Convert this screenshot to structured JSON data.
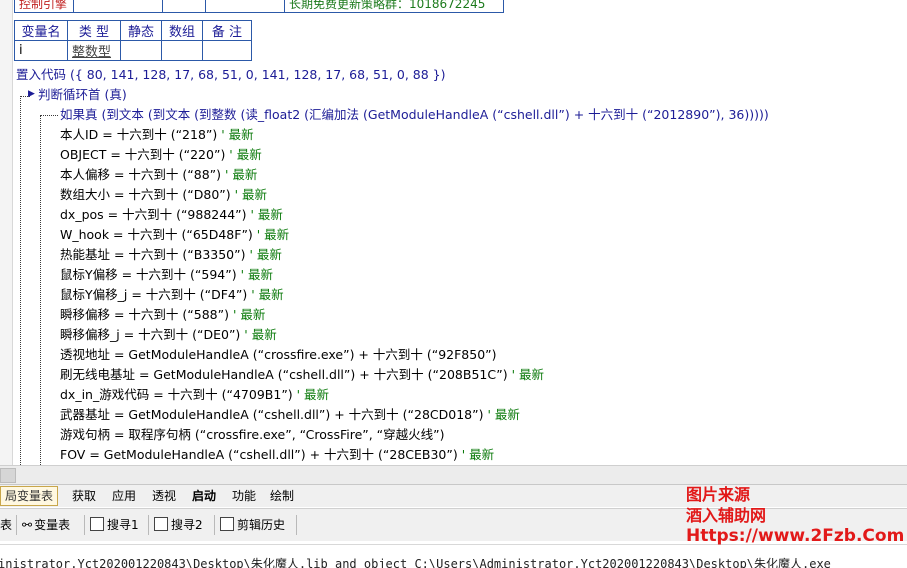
{
  "top_table": {
    "cell1": "控制引擎",
    "cell5": "长期免费更新策略群：1018672245"
  },
  "var_table": {
    "headers": [
      "变量名",
      "类 型",
      "静态",
      "数组",
      "备 注"
    ],
    "row": [
      "i",
      "整数型",
      "",
      "",
      ""
    ]
  },
  "code": {
    "embed": "置入代码 ({ 80, 141, 128, 17, 68, 51, 0, 141, 128, 17, 68, 51, 0, 88 })",
    "loop": "判断循环首 (真)",
    "if_line": "如果真 (到文本 (到文本 (到整数 (读_float2 (汇编加法 (GetModuleHandleA (“cshell.dll”) + 十六到十 (“2012890”), 36)))))",
    "lines": [
      "本人ID = 十六到十 (“218”) ' 最新",
      "OBJECT = 十六到十 (“220”) ' 最新",
      "本人偏移 = 十六到十 (“88”) ' 最新",
      "数组大小 = 十六到十 (“D80”) ' 最新",
      "dx_pos = 十六到十 (“988244”) ' 最新",
      "W_hook = 十六到十 (“65D48F”) ' 最新",
      "热能基址 = 十六到十 (“B3350”) ' 最新",
      "鼠标Y偏移 = 十六到十 (“594”) ' 最新",
      "鼠标Y偏移_j = 十六到十 (“DF4”) ' 最新",
      "瞬移偏移 = 十六到十 (“588”) ' 最新",
      "瞬移偏移_j = 十六到十 (“DE0”) ' 最新",
      "透视地址 = GetModuleHandleA (“crossfire.exe”) + 十六到十 (“92F850”)",
      "刷无线电基址 = GetModuleHandleA (“cshell.dll”) + 十六到十 (“208B51C”) ' 最新",
      "dx_in_游戏代码 = 十六到十 (“4709B1”) ' 最新",
      "武器基址 = GetModuleHandleA (“cshell.dll”) + 十六到十 (“28CD018”) ' 最新",
      "游戏句柄 = 取程序句柄 (“crossfire.exe”, “CrossFire”, “穿越火线”)",
      "FOV = GetModuleHandleA (“cshell.dll”) + 十六到十 (“28CEB30”) ' 最新"
    ]
  },
  "tabs": [
    "局变量表",
    "获取",
    "应用",
    "透视",
    "启动",
    "功能",
    "绘制"
  ],
  "active_tab": "启动",
  "bottom_toolbar": [
    "表",
    "变量表",
    "搜寻1",
    "搜寻2",
    "剪辑历史"
  ],
  "status_path": "inistrator.Yct202001220843\\Desktop\\朱化魔人.lib and object C:\\Users\\Administrator.Yct202001220843\\Desktop\\朱化魔人.exe",
  "watermark": {
    "line1": "图片来源",
    "line2": "酒入辅助网",
    "line3": "Https://www.2Fzb.Com"
  }
}
